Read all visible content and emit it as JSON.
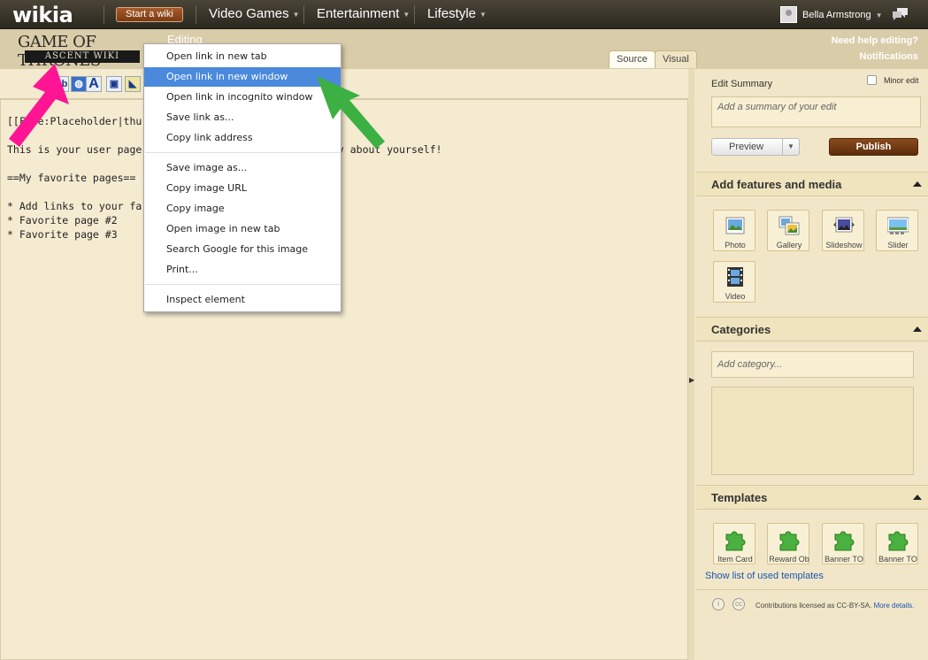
{
  "topnav": {
    "logo": "wikia",
    "start_wiki": "Start a wiki",
    "items": [
      "Video Games",
      "Entertainment",
      "Lifestyle"
    ],
    "user": "Bella Armstrong"
  },
  "header": {
    "wiki_logo_line1": "GAME OF THRONES",
    "wiki_logo_line2": "ASCENT WIKI",
    "editing": "Editing",
    "tabs": [
      "Source",
      "Visual"
    ],
    "need_help": "Need help editing?",
    "notifications": "Notifications"
  },
  "toolbar": {
    "italic_label": "Ab",
    "link_label": "A"
  },
  "editor": {
    "lines": [
      "[[File:Placeholder|thu",
      "",
      "This is your user page                    the community about yourself!",
      "",
      "==My favorite pages==",
      "",
      "* Add links to your fa",
      "* Favorite page #2",
      "* Favorite page #3"
    ]
  },
  "context_menu": {
    "items": [
      "Open link in new tab",
      "Open link in new window",
      "Open link in incognito window",
      "Save link as...",
      "Copy link address",
      "Save image as...",
      "Copy image URL",
      "Copy image",
      "Open image in new tab",
      "Search Google for this image",
      "Print...",
      "Inspect element"
    ],
    "highlighted": "Open link in new window"
  },
  "rail": {
    "edit_summary_label": "Edit Summary",
    "minor_edit": "Minor edit",
    "summary_placeholder": "Add a summary of your edit",
    "preview": "Preview",
    "publish": "Publish",
    "features_title": "Add features and media",
    "media": [
      "Photo",
      "Gallery",
      "Slideshow",
      "Slider",
      "Video"
    ],
    "categories_title": "Categories",
    "category_placeholder": "Add category...",
    "templates_title": "Templates",
    "templates": [
      "Item Card",
      "Reward Ob",
      "Banner TO",
      "Banner TO"
    ],
    "show_templates": "Show list of used templates",
    "license_text": "Contributions licensed as CC-BY-SA.",
    "license_link": "More details."
  },
  "colors": {
    "highlight": "#4a89dc",
    "pink_arrow": "#ff1493",
    "green_arrow": "#3cb043",
    "publish": "#6b3510"
  }
}
